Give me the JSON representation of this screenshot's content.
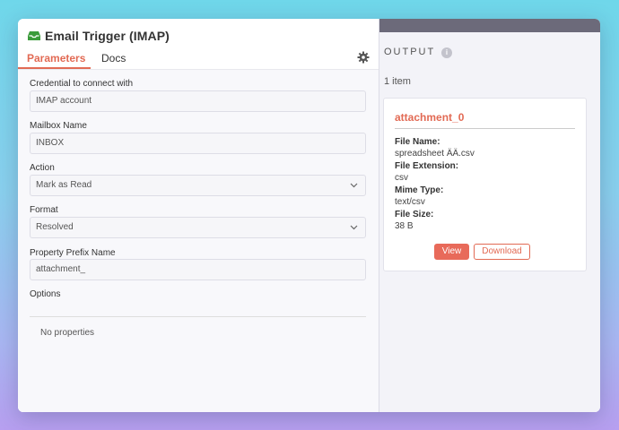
{
  "node": {
    "title": "Email Trigger (IMAP)",
    "icon": "inbox-icon"
  },
  "tabs": {
    "parameters": "Parameters",
    "docs": "Docs"
  },
  "params": {
    "credential_label": "Credential to connect with",
    "credential_value": "IMAP account",
    "mailbox_label": "Mailbox Name",
    "mailbox_value": "INBOX",
    "action_label": "Action",
    "action_value": "Mark as Read",
    "format_label": "Format",
    "format_value": "Resolved",
    "prefix_label": "Property Prefix Name",
    "prefix_value": "attachment_",
    "options_label": "Options",
    "no_properties": "No properties"
  },
  "output": {
    "label": "OUTPUT",
    "count": "1 item",
    "card": {
      "title": "attachment_0",
      "file_name_key": "File Name:",
      "file_name_val": "spreadsheet ÄÄ.csv",
      "ext_key": "File Extension:",
      "ext_val": "csv",
      "mime_key": "Mime Type:",
      "mime_val": "text/csv",
      "size_key": "File Size:",
      "size_val": "38 B",
      "view": "View",
      "download": "Download"
    }
  },
  "colors": {
    "accent": "#e26a54",
    "node_green": "#3b9b3b"
  }
}
